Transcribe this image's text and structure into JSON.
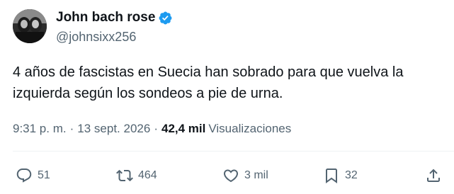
{
  "author": {
    "display_name": "John bach rose",
    "handle": "@johnsixx256"
  },
  "tweet": {
    "text": "4 años de fascistas en Suecia han sobrado para que vuelva la izquierda según los sondeos a pie de urna."
  },
  "meta": {
    "time": "9:31 p. m.",
    "separator": "·",
    "date": "13 sept. 2026",
    "views_count": "42,4 mil",
    "views_label": "Visualizaciones"
  },
  "actions": {
    "replies": "51",
    "retweets": "464",
    "likes": "3 mil",
    "bookmarks": "32"
  },
  "icons": {
    "verified": "verified-badge-icon",
    "reply": "reply-icon",
    "retweet": "retweet-icon",
    "like": "heart-icon",
    "bookmark": "bookmark-icon",
    "share": "share-icon"
  },
  "colors": {
    "accent": "#1d9bf0",
    "text_primary": "#0f1419",
    "text_secondary": "#536471",
    "divider": "#eff3f4"
  }
}
